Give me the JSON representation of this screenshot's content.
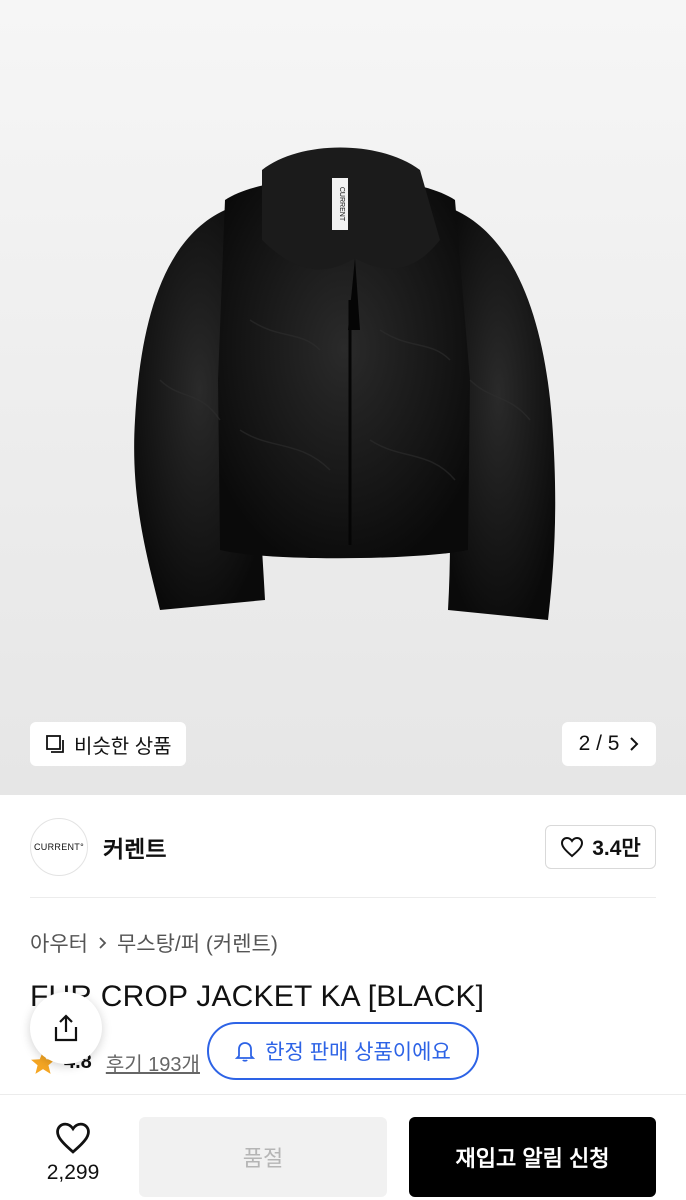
{
  "gallery": {
    "similar_label": "비슷한 상품",
    "pager": "2 / 5",
    "jacket_tag": "CURRENT"
  },
  "brand": {
    "logo_text": "CURRENT°",
    "name": "커렌트",
    "like_count": "3.4만"
  },
  "product": {
    "breadcrumb": [
      "아우터",
      "무스탕/퍼 (커렌트)"
    ],
    "title": "FUR CROP JACKET KA [BLACK]",
    "rating": "4.8",
    "review_label": "후기 193개"
  },
  "notice": {
    "limited_label": "한정 판매 상품이에요"
  },
  "bottom": {
    "wish_count": "2,299",
    "soldout_label": "품절",
    "restock_label": "재입고 알림 신청"
  },
  "colors": {
    "accent_blue": "#2d63e6",
    "star": "#f5a623",
    "primary_button": "#000000"
  },
  "icons": [
    "similar-icon",
    "chevron-right-icon",
    "heart-icon",
    "share-icon",
    "bell-icon",
    "star-icon"
  ]
}
